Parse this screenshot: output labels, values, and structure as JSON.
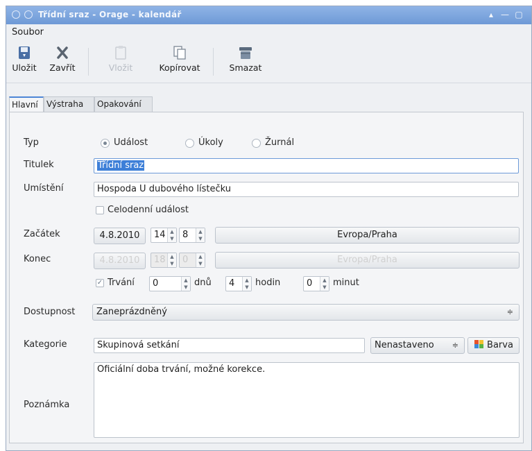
{
  "window": {
    "title": "Třídní sraz - Orage - kalendář"
  },
  "menu": {
    "soubor": "Soubor"
  },
  "toolbar": {
    "save": "Uložit",
    "close": "Zavřít",
    "paste": "Vložit",
    "copy": "Kopírovat",
    "delete": "Smazat"
  },
  "tabs": [
    "Hlavní",
    "Výstraha",
    "Opakování"
  ],
  "form": {
    "type_label": "Typ",
    "type_options": [
      "Událost",
      "Úkoly",
      "Žurnál"
    ],
    "type_selected": "Událost",
    "title_label": "Titulek",
    "title_value": "Třídní sraz",
    "location_label": "Umístění",
    "location_value": "Hospoda U dubového lístečku",
    "allday_label": "Celodenní událost",
    "start_label": "Začátek",
    "start_date": "4.8.2010",
    "start_hour": "14",
    "start_min": "8",
    "start_tz": "Evropa/Praha",
    "end_label": "Konec",
    "end_date": "4.8.2010",
    "end_hour": "18",
    "end_min": "0",
    "end_tz": "Evropa/Praha",
    "duration_label": "Trvání",
    "duration_days": "0",
    "days_label": "dnů",
    "duration_hours": "4",
    "hours_label": "hodin",
    "duration_minutes": "0",
    "minutes_label": "minut",
    "availability_label": "Dostupnost",
    "availability_value": "Zaneprázdněný",
    "category_label": "Kategorie",
    "category_value": "Skupinová setkání",
    "category_select": "Nenastaveno",
    "color_button": "Barva",
    "note_label": "Poznámka",
    "note_value": "Oficiální doba trvání, možné korekce."
  },
  "colors": {
    "accent": "#3d7fd8",
    "titlebar": "#7ea6de"
  }
}
